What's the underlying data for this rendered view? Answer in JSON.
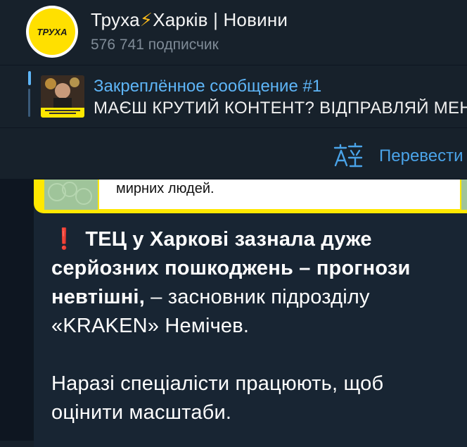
{
  "header": {
    "channel_title": "Труха",
    "channel_title_suffix": "Харків | Новини",
    "bolt": "⚡",
    "subscribers": "576 741 подписчик",
    "avatar_logo": "ТРУХА"
  },
  "pinned": {
    "label": "Закреплённое сообщение #1",
    "text": "МАЄШ КРУТИЙ КОНТЕНТ? ВІДПРАВЛЯЙ МЕНІ"
  },
  "translate": {
    "label": "Перевести",
    "icon": "translate-icon"
  },
  "message": {
    "media_caption": "мирних людей.",
    "exclaim": "❗",
    "bold_text": "ТЕЦ у Харкові зазнала дуже серйозних пошкоджень – прогнози невтішні,",
    "normal_text": " – засновник підрозділу «KRAKEN» Немічев.",
    "paragraph2": "Наразі спеціалісти працюють, щоб оцінити масштаби."
  },
  "colors": {
    "accent": "#5eb5f7",
    "background": "#17212b",
    "bubble": "#182533",
    "media_frame": "#ffe800"
  }
}
